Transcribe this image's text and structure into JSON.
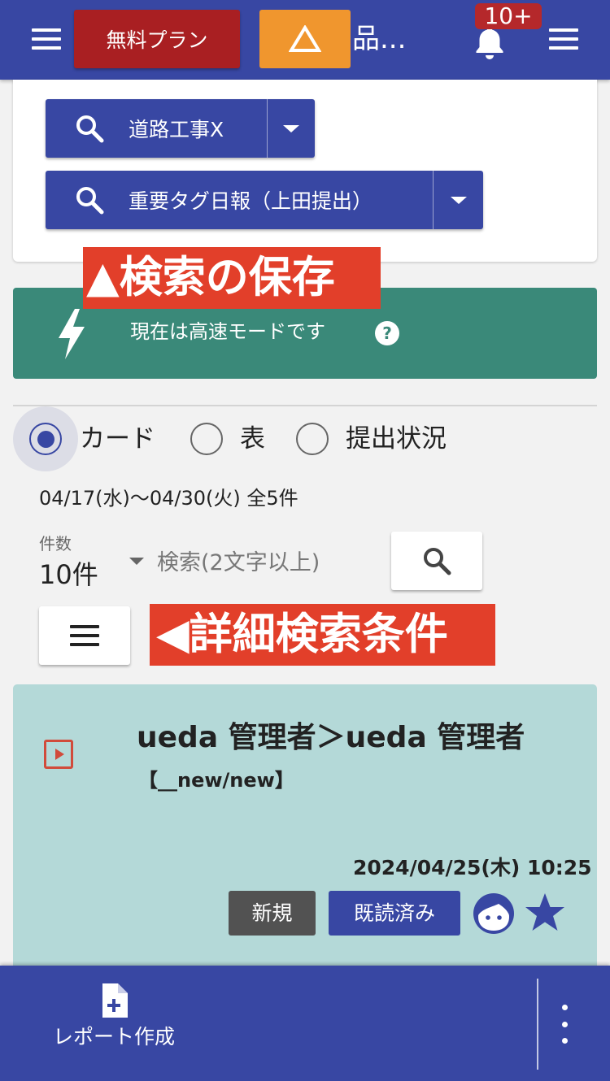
{
  "header": {
    "free_plan_label": "無料プラン",
    "title": "品...",
    "notification_badge": "10+"
  },
  "saved_searches": [
    {
      "label": "道路工事X"
    },
    {
      "label": "重要タグ日報（上田提出）"
    }
  ],
  "annotations": {
    "save_search": "▲検索の保存",
    "detail_search": "◀詳細検索条件"
  },
  "fast_mode": {
    "text": "現在は高速モードです",
    "help": "?"
  },
  "view_toggle": {
    "options": [
      "カード",
      "表",
      "提出状況"
    ],
    "selected": "カード"
  },
  "filter": {
    "date_range": "04/17(水)〜04/30(火) 全5件",
    "count_label": "件数",
    "count_value": "10件",
    "search_placeholder": "検索(2文字以上)"
  },
  "report": {
    "title": "ueda 管理者＞ueda 管理者",
    "subtitle": "【__new/new】",
    "timestamp": "2024/04/25(木) 10:25",
    "tag_new": "新規",
    "tag_read": "既読済み"
  },
  "bottom_bar": {
    "create_label": "レポート作成"
  },
  "colors": {
    "primary": "#3847a3",
    "free_plan": "#a91f22",
    "warning": "#f0962e",
    "fast_mode": "#3a8979",
    "annotation": "#e23f2a",
    "card_bg": "#b4d9d8",
    "tag_new": "#525252"
  },
  "icons": [
    "menu-icon",
    "warning-icon",
    "bell-icon",
    "search-icon",
    "caret-down-icon",
    "lightning-icon",
    "help-icon",
    "play-icon",
    "face-icon",
    "star-icon",
    "file-plus-icon",
    "more-vertical-icon"
  ]
}
